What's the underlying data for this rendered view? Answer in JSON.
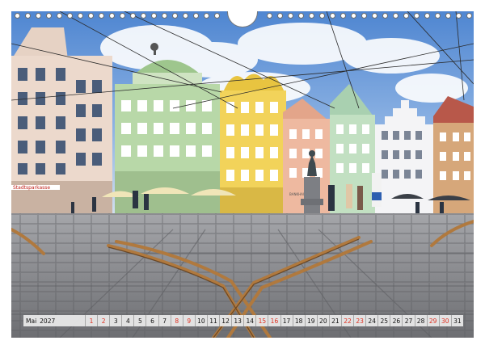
{
  "calendar": {
    "month_name": "Mai",
    "year": "2027",
    "days": [
      {
        "n": "1",
        "weekend": true
      },
      {
        "n": "2",
        "weekend": true
      },
      {
        "n": "3",
        "weekend": false
      },
      {
        "n": "4",
        "weekend": false
      },
      {
        "n": "5",
        "weekend": false
      },
      {
        "n": "6",
        "weekend": false
      },
      {
        "n": "7",
        "weekend": false
      },
      {
        "n": "8",
        "weekend": true
      },
      {
        "n": "9",
        "weekend": true
      },
      {
        "n": "10",
        "weekend": false
      },
      {
        "n": "11",
        "weekend": false
      },
      {
        "n": "12",
        "weekend": false
      },
      {
        "n": "13",
        "weekend": false
      },
      {
        "n": "14",
        "weekend": false
      },
      {
        "n": "15",
        "weekend": true
      },
      {
        "n": "16",
        "weekend": true
      },
      {
        "n": "17",
        "weekend": false
      },
      {
        "n": "18",
        "weekend": false
      },
      {
        "n": "19",
        "weekend": false
      },
      {
        "n": "20",
        "weekend": false
      },
      {
        "n": "21",
        "weekend": false
      },
      {
        "n": "22",
        "weekend": true
      },
      {
        "n": "23",
        "weekend": true
      },
      {
        "n": "24",
        "weekend": false
      },
      {
        "n": "25",
        "weekend": false
      },
      {
        "n": "26",
        "weekend": false
      },
      {
        "n": "27",
        "weekend": false
      },
      {
        "n": "28",
        "weekend": false
      },
      {
        "n": "29",
        "weekend": true
      },
      {
        "n": "30",
        "weekend": true
      },
      {
        "n": "31",
        "weekend": false
      }
    ]
  },
  "photo": {
    "storefront_sign": "Stadtsparkasse",
    "building_sign": "BANKHAUS"
  },
  "colors": {
    "weekend": "#e03020",
    "sky": "#5b8fd6",
    "mint_facade": "#b8d8a8",
    "yellow_facade": "#f2d35a",
    "pink_facade": "#eeb9a0",
    "cobblestone": "#8e8f93",
    "tram_rails": "#b0793e"
  }
}
